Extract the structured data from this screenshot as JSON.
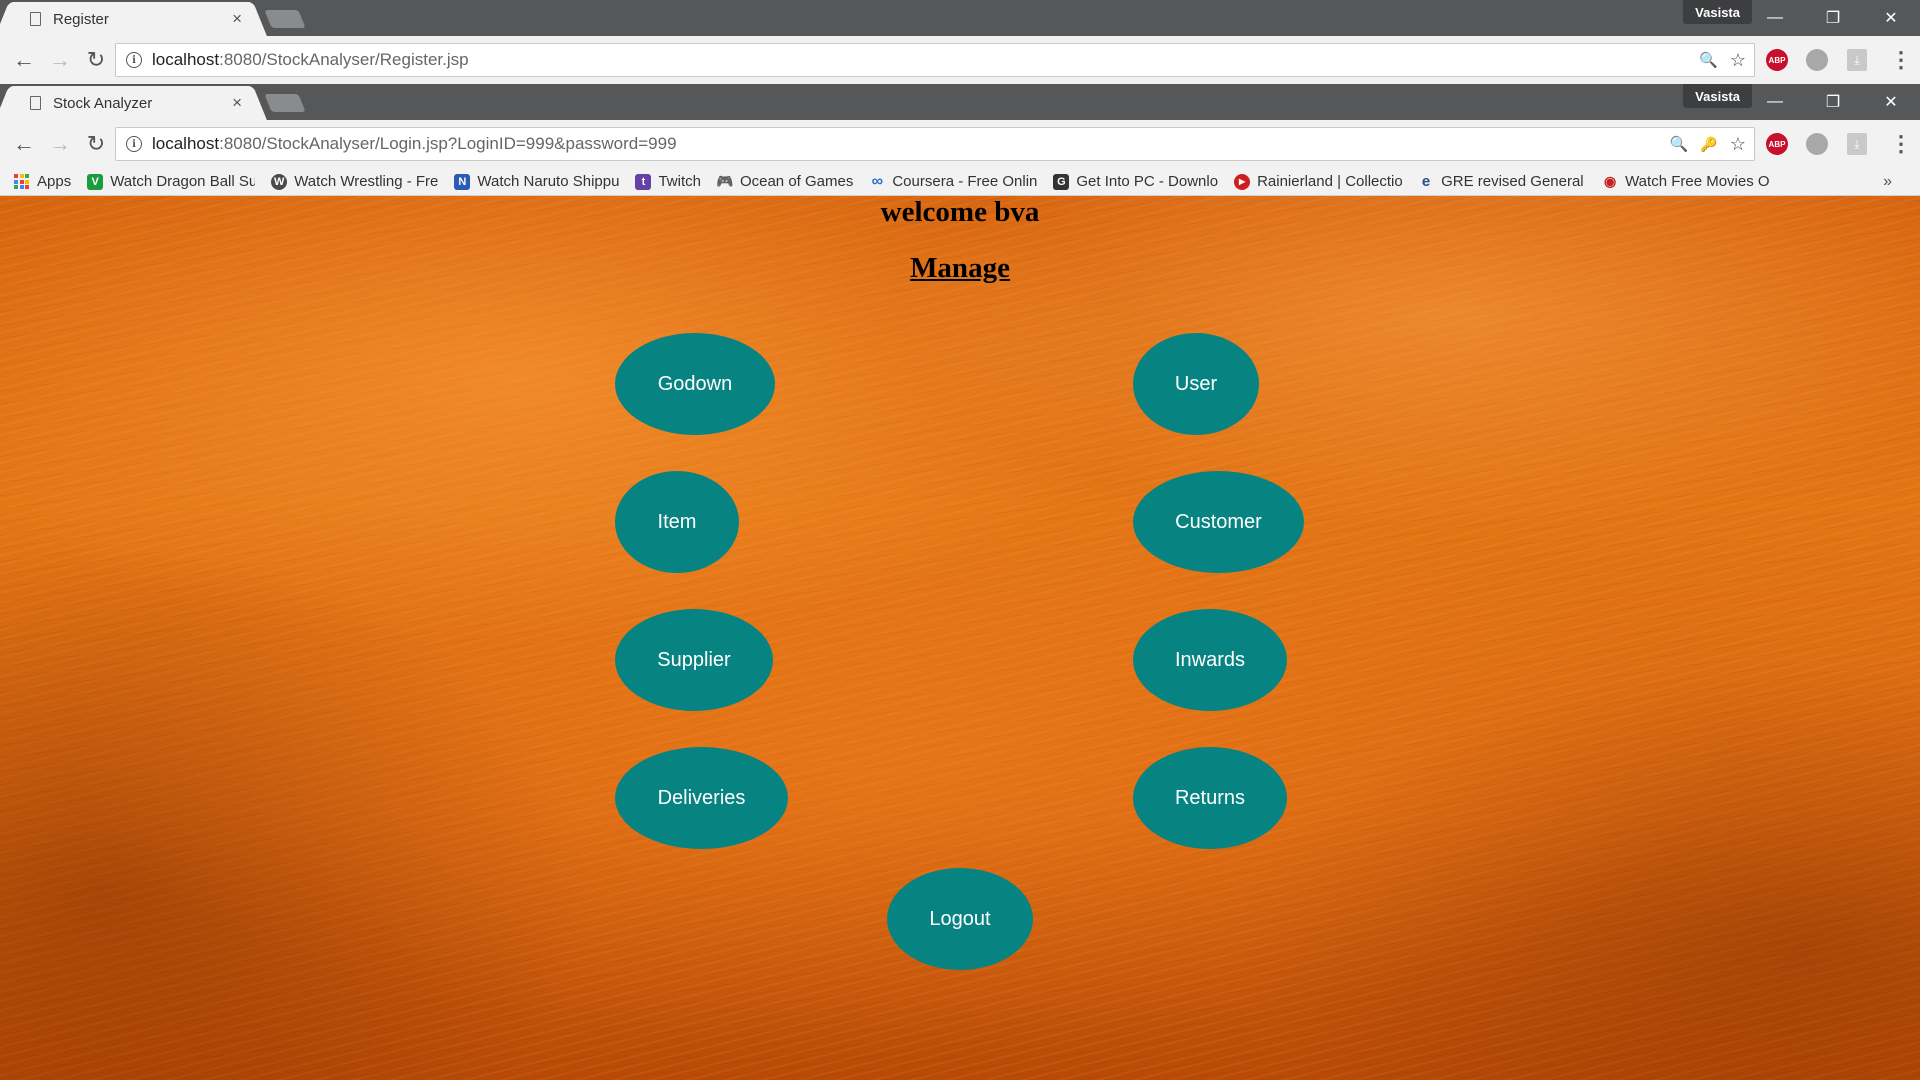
{
  "back_window": {
    "tab_title": "Register",
    "profile": "Vasista",
    "url_host": "localhost",
    "url_path": ":8080/StockAnalyser/Register.jsp"
  },
  "front_window": {
    "tab_title": "Stock Analyzer",
    "profile": "Vasista",
    "url_host": "localhost",
    "url_path": ":8080/StockAnalyser/Login.jsp?LoginID=999&password=999"
  },
  "icons": {
    "back": "←",
    "forward": "→",
    "reload": "↻",
    "close": "×",
    "minimize": "—",
    "restore": "❐",
    "win_close": "✕",
    "zoom": "🔍",
    "star": "☆",
    "key": "🔑",
    "more": "»",
    "menu": "⋮"
  },
  "bookmarks": [
    {
      "label": "Apps",
      "color": "#ffffff",
      "glyph": ""
    },
    {
      "label": "Watch Dragon Ball Su",
      "color": "#1a9b3d",
      "glyph": "V"
    },
    {
      "label": "Watch Wrestling - Fre",
      "color": "#4a4a4a",
      "glyph": "W"
    },
    {
      "label": "Watch Naruto Shippu",
      "color": "#2a5bb5",
      "glyph": "N"
    },
    {
      "label": "Twitch",
      "color": "#6441a5",
      "glyph": "t"
    },
    {
      "label": "Ocean of Games",
      "color": "#b3161c",
      "glyph": "🎮"
    },
    {
      "label": "Coursera - Free Onlin",
      "color": "#2a73cc",
      "glyph": "∞"
    },
    {
      "label": "Get Into PC - Downlo",
      "color": "#333333",
      "glyph": "G"
    },
    {
      "label": "Rainierland | Collectio",
      "color": "#d01c1c",
      "glyph": "▶"
    },
    {
      "label": "GRE revised General T",
      "color": "#2a4d8f",
      "glyph": "e"
    },
    {
      "label": "Watch Free Movies O",
      "color": "#c41e1e",
      "glyph": "◉"
    }
  ],
  "page": {
    "welcome": "welcome bva",
    "manage": "Manage",
    "buttons": {
      "godown": "Godown",
      "user": "User",
      "item": "Item",
      "customer": "Customer",
      "supplier": "Supplier",
      "inwards": "Inwards",
      "deliveries": "Deliveries",
      "returns": "Returns",
      "logout": "Logout"
    }
  },
  "colors": {
    "button_fill": "#078482",
    "background_orange": "#e37515",
    "titlebar": "#555759"
  }
}
